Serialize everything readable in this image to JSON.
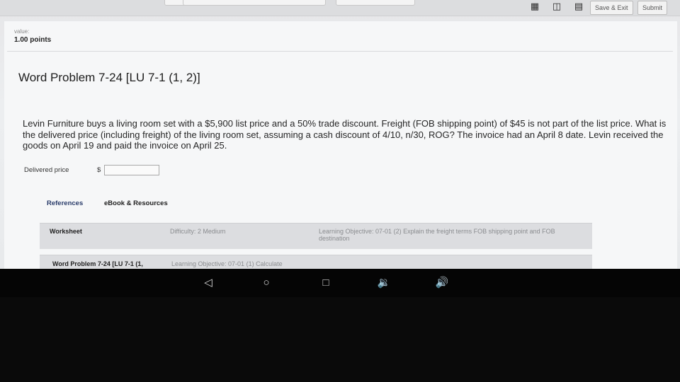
{
  "toolbar": {
    "save_exit_label": "Save & Exit",
    "submit_label": "Submit"
  },
  "question": {
    "value_label": "value:",
    "points": "1.00 points",
    "title": "Word Problem 7-24 [LU 7-1 (1, 2)]",
    "problem_text": "Levin Furniture buys a living room set with a $5,900 list price and a 50% trade discount. Freight (FOB shipping point) of $45 is not part of the list price. What is the delivered price (including freight) of the living room set, assuming a cash discount of 4/10, n/30, ROG? The invoice had an April 8 date. Levin received the goods on April 19 and paid the invoice on April 25.",
    "answer_label": "Delivered price",
    "currency_symbol": "$",
    "answer_value": ""
  },
  "references": {
    "tabs": [
      {
        "label": "References"
      },
      {
        "label": "eBook & Resources"
      }
    ],
    "rows": [
      {
        "type": "Worksheet",
        "difficulty": "Difficulty: 2 Medium",
        "objective": "Learning Objective: 07-01 (2) Explain the freight terms FOB shipping point and FOB destination"
      },
      {
        "type": "Word Problem 7-24 [LU 7-1 (1,",
        "objective": "Learning Objective: 07-01 (1) Calculate"
      }
    ]
  },
  "colors": {
    "accent_tab": "#2b3d6b",
    "muted_text": "#8a8c8f"
  },
  "icons": {
    "toolbar": [
      "calculator-icon",
      "print-icon",
      "menu-icon"
    ],
    "navigation": [
      "back-icon",
      "home-icon",
      "recents-icon",
      "volume-down-icon",
      "volume-up-icon"
    ]
  }
}
